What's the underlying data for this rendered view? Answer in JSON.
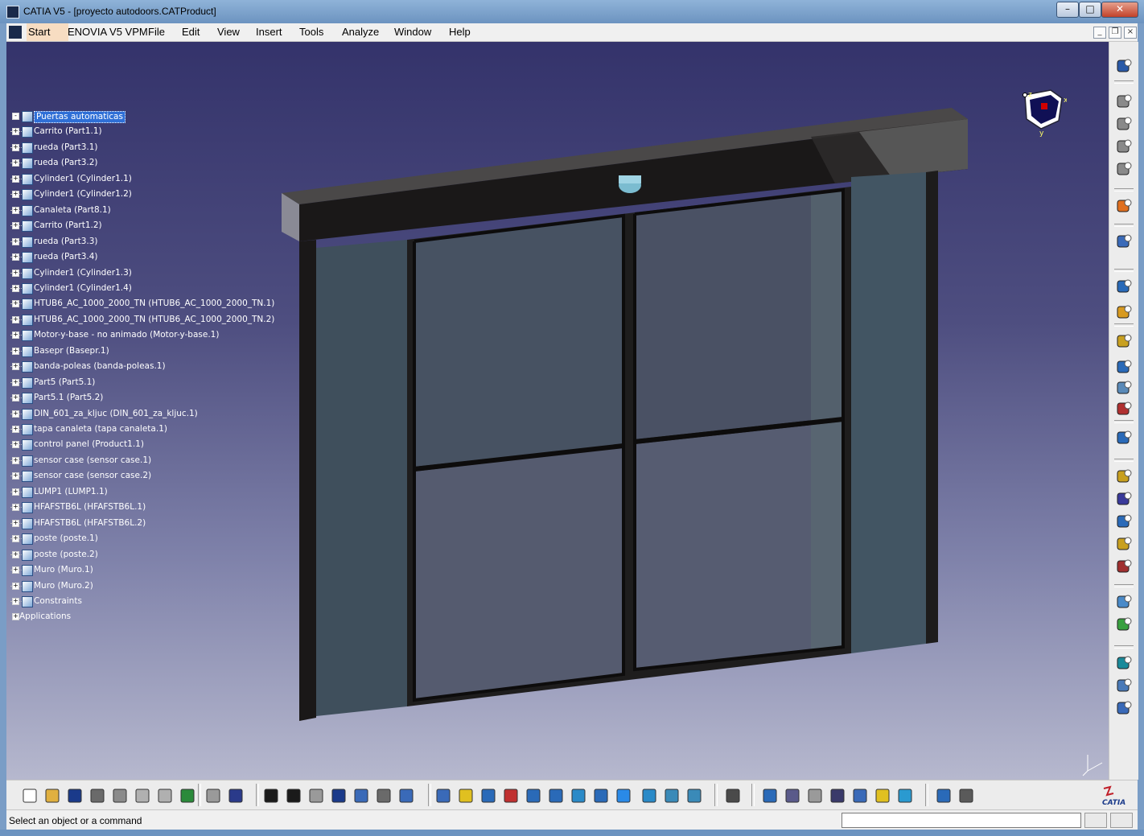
{
  "window": {
    "title": "CATIA V5 - [proyecto autodoors.CATProduct]"
  },
  "menu": {
    "start": "Start",
    "enovia": "ENOVIA V5 VPM",
    "file": "File",
    "edit": "Edit",
    "view": "View",
    "insert": "Insert",
    "tools": "Tools",
    "analyze": "Analyze",
    "window": "Window",
    "help": "Help"
  },
  "tree": {
    "root": "Puertas automaticas",
    "items": [
      "Carrito (Part1.1)",
      "rueda (Part3.1)",
      "rueda (Part3.2)",
      "Cylinder1 (Cylinder1.1)",
      "Cylinder1 (Cylinder1.2)",
      "Canaleta (Part8.1)",
      "Carrito (Part1.2)",
      "rueda (Part3.3)",
      "rueda (Part3.4)",
      "Cylinder1 (Cylinder1.3)",
      "Cylinder1 (Cylinder1.4)",
      "HTUB6_AC_1000_2000_TN (HTUB6_AC_1000_2000_TN.1)",
      "HTUB6_AC_1000_2000_TN (HTUB6_AC_1000_2000_TN.2)",
      "Motor-y-base - no animado (Motor-y-base.1)",
      "Basepr (Basepr.1)",
      "banda-poleas (banda-poleas.1)",
      "Part5 (Part5.1)",
      "Part5.1 (Part5.2)",
      "DIN_601_za_kljuc (DIN_601_za_kljuc.1)",
      "tapa canaleta (tapa canaleta.1)",
      "control panel (Product1.1)",
      "sensor case (sensor case.1)",
      "sensor case (sensor case.2)",
      "LUMP1 (LUMP1.1)",
      "HFAFSTB6L (HFAFSTB6L.1)",
      "HFAFSTB6L (HFAFSTB6L.2)",
      "poste (poste.1)",
      "poste (poste.2)",
      "Muro (Muro.1)",
      "Muro (Muro.2)",
      "Constraints"
    ],
    "applications": "Applications"
  },
  "compass": {
    "x": "x",
    "y": "y",
    "z": "z"
  },
  "status": {
    "message": "Select an object or a command"
  },
  "brand": {
    "logo_text": "CATIA"
  },
  "colors": {
    "accent": "#2f6fd6",
    "viewport_top": "#34336b",
    "viewport_bottom": "#b6b8ce"
  }
}
